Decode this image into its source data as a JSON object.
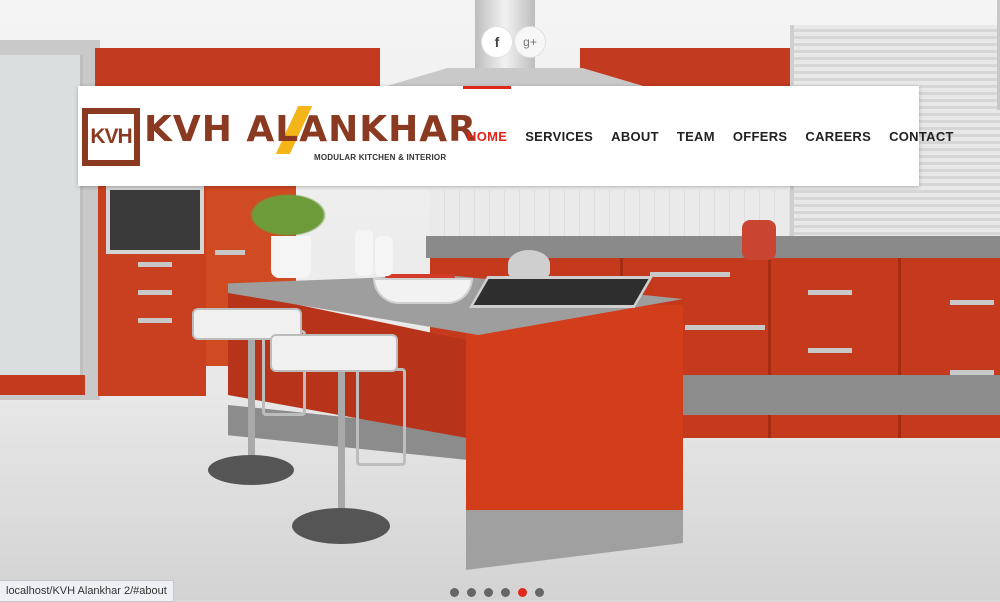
{
  "brand": {
    "logo_mark": "KVH",
    "name": "KVH ALANKHAR",
    "tagline": "MODULAR KITCHEN & INTERIOR"
  },
  "social": {
    "facebook_glyph": "f",
    "googleplus_glyph": "g+"
  },
  "nav": {
    "items": [
      {
        "label": "HOME",
        "active": true
      },
      {
        "label": "SERVICES",
        "active": false
      },
      {
        "label": "ABOUT",
        "active": false
      },
      {
        "label": "TEAM",
        "active": false
      },
      {
        "label": "OFFERS",
        "active": false
      },
      {
        "label": "CAREERS",
        "active": false
      },
      {
        "label": "CONTACT",
        "active": false
      }
    ]
  },
  "slider": {
    "slide_count": 6,
    "active_index": 4
  },
  "status_bar": {
    "url": "localhost/KVH Alankhar 2/#about"
  },
  "colors": {
    "accent": "#e0271b",
    "brand": "#8b3a22",
    "brand_highlight": "#f4b518",
    "kitchen_red": "#c53a1d"
  }
}
